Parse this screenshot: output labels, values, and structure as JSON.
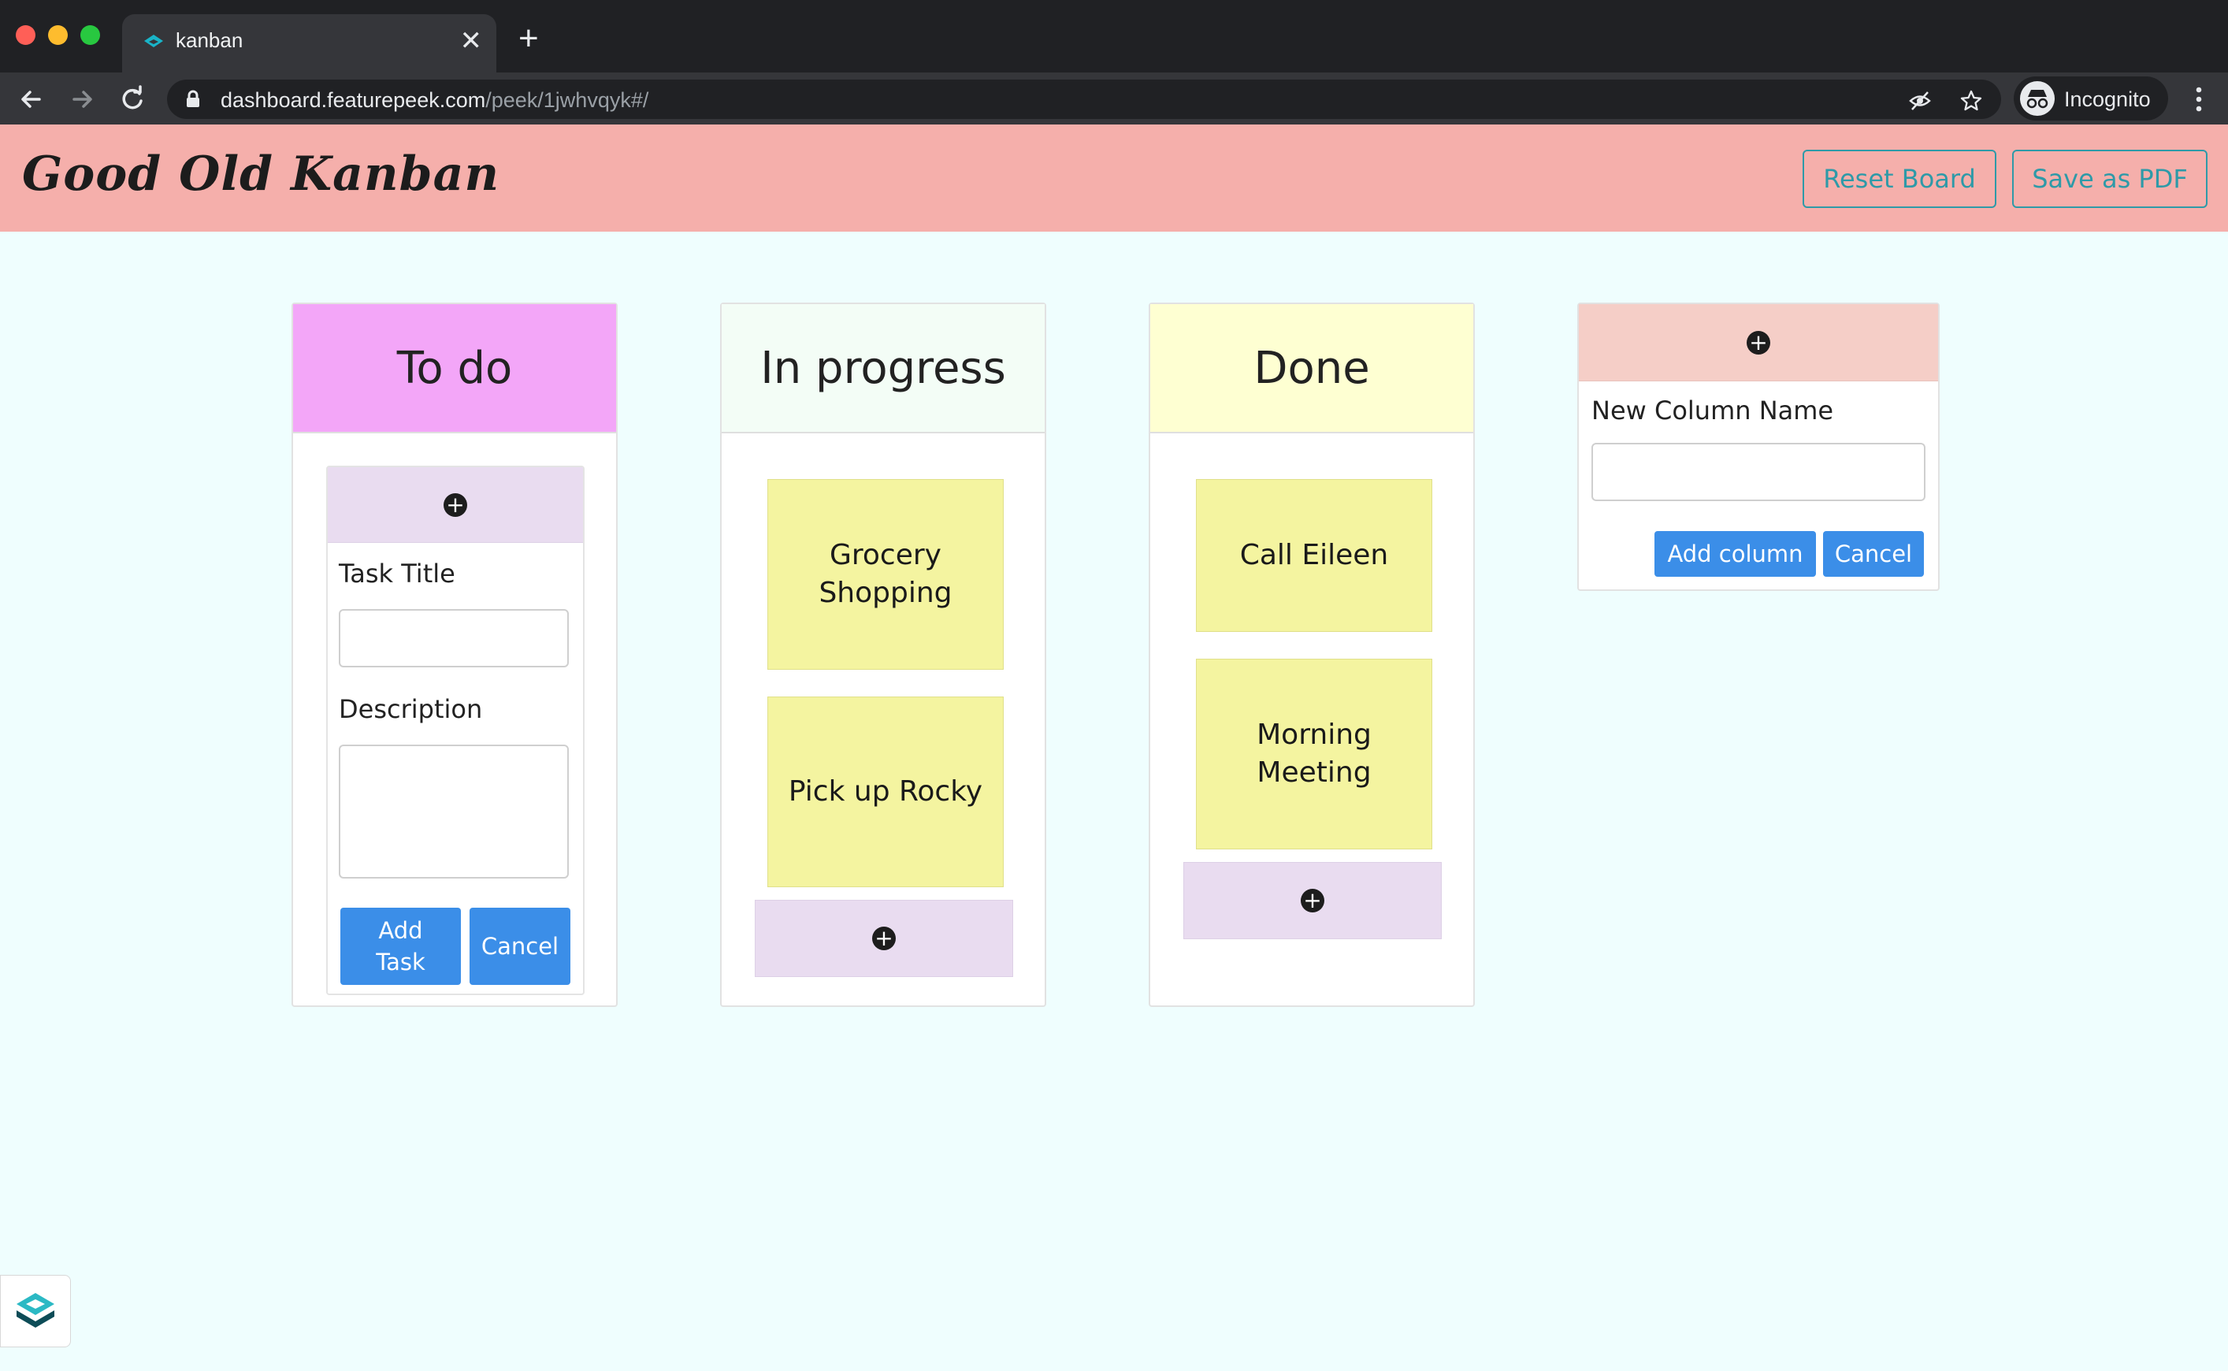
{
  "browser": {
    "tab_title": "kanban",
    "url_host": "dashboard.featurepeek.com",
    "url_path": "/peek/1jwhvqyk#/",
    "profile_label": "Incognito",
    "icons": [
      "back-icon",
      "forward-icon",
      "reload-icon",
      "lock-icon",
      "eye-off-icon",
      "star-icon",
      "incognito-icon",
      "more-vert-icon"
    ]
  },
  "header": {
    "logo": "Good Old Kanban",
    "reset_label": "Reset Board",
    "pdf_label": "Save as PDF",
    "background": "#f5afab",
    "accent": "#2e9aa8"
  },
  "columns": [
    {
      "title": "To do",
      "color": "#f3a6f8",
      "form": {
        "task_title_label": "Task Title",
        "task_title_value": "",
        "description_label": "Description",
        "description_value": "",
        "add_label": "Add\nTask",
        "cancel_label": "Cancel"
      }
    },
    {
      "title": "In progress",
      "color": "#f3fdf6",
      "cards": [
        "Grocery Shopping",
        "Pick up Rocky"
      ]
    },
    {
      "title": "Done",
      "color": "#feffd2",
      "cards": [
        "Call Eileen",
        "Morning Meeting"
      ]
    }
  ],
  "new_column": {
    "label": "New Column Name",
    "value": "",
    "add_label": "Add column",
    "cancel_label": "Cancel",
    "color": "#f5cec7"
  },
  "colors": {
    "board_bg": "#effefe",
    "note": "#f4f4a0",
    "add_bar": "#e9dcf0",
    "primary_button": "#3b8ee8"
  }
}
